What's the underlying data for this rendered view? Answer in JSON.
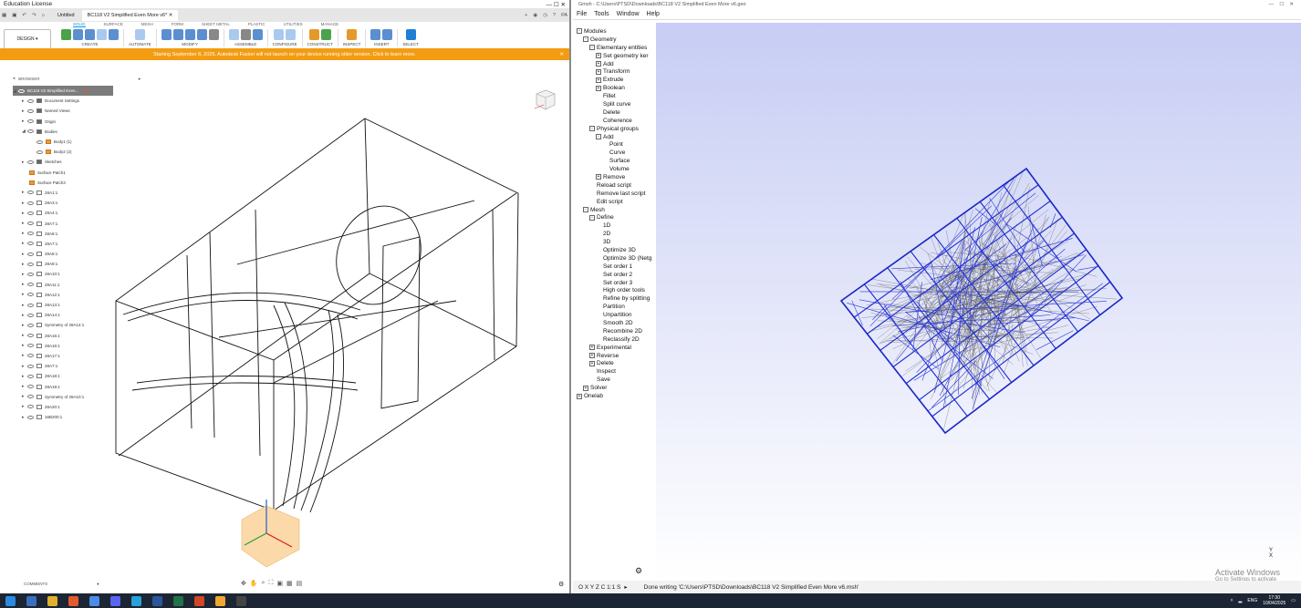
{
  "fusion": {
    "window_title": "Education License",
    "tabs": {
      "untitled": "Untitled",
      "active": "BC118 V2 Simplified Even More v6*"
    },
    "ribbon_tabs": [
      "SOLID",
      "SURFACE",
      "MESH",
      "FORM",
      "SHEET METAL",
      "PLASTIC",
      "UTILITIES",
      "MANAGE"
    ],
    "design_button": "DESIGN",
    "groups": [
      "CREATE",
      "AUTOMATE",
      "MODIFY",
      "ASSEMBLE",
      "CONFIGURE",
      "CONSTRUCT",
      "INSPECT",
      "INSERT",
      "SELECT"
    ],
    "banner": "Starting September 8, 2025, Autodesk Fusion will not launch on your device running older version. Click to learn more.",
    "browser_label": "BROWSER",
    "root_item": "BC118 V2 Simplified Even...",
    "tree_items": [
      "Document Settings",
      "Named Views",
      "Origin",
      "Bodies",
      "Body1 (1)",
      "Body2 (2)",
      "Sketches",
      "Surface Patch1",
      "Surface Patch3",
      "28A1:1",
      "28A3:1",
      "28A4:1",
      "28A7:1",
      "28A8:1",
      "28A7:1",
      "28A6:1",
      "28A8:1",
      "28A10:1",
      "28A11:1",
      "28A12:1",
      "28A13:1",
      "28A14:1",
      "Symmetry of 28A14:1",
      "28A15:1",
      "28A16:1",
      "28A17:1",
      "28A7:1",
      "28A18:1",
      "28A19:1",
      "Symmetry of 28A10:1",
      "28A20:1",
      "16B200:1"
    ],
    "comments_label": "COMMENTS"
  },
  "gmsh": {
    "window_title": "Gmsh - C:\\Users\\PTSD\\Downloads\\BC118 V2 Simplified Even More v6.geo",
    "menu": [
      "File",
      "Tools",
      "Window",
      "Help"
    ],
    "tree": [
      {
        "t": "Modules",
        "d": 0,
        "pm": "-"
      },
      {
        "t": "Geometry",
        "d": 1,
        "pm": "-"
      },
      {
        "t": "Elementary entities",
        "d": 2,
        "pm": "-"
      },
      {
        "t": "Set geometry ker",
        "d": 3,
        "pm": "+"
      },
      {
        "t": "Add",
        "d": 3,
        "pm": "+"
      },
      {
        "t": "Transform",
        "d": 3,
        "pm": "+"
      },
      {
        "t": "Extrude",
        "d": 3,
        "pm": "+"
      },
      {
        "t": "Boolean",
        "d": 3,
        "pm": "+"
      },
      {
        "t": "Fillet",
        "d": 3,
        "pm": ""
      },
      {
        "t": "Split curve",
        "d": 3,
        "pm": ""
      },
      {
        "t": "Delete",
        "d": 3,
        "pm": ""
      },
      {
        "t": "Coherence",
        "d": 3,
        "pm": ""
      },
      {
        "t": "Physical groups",
        "d": 2,
        "pm": "-"
      },
      {
        "t": "Add",
        "d": 3,
        "pm": "-"
      },
      {
        "t": "Point",
        "d": 4,
        "pm": ""
      },
      {
        "t": "Curve",
        "d": 4,
        "pm": ""
      },
      {
        "t": "Surface",
        "d": 4,
        "pm": ""
      },
      {
        "t": "Volume",
        "d": 4,
        "pm": ""
      },
      {
        "t": "Remove",
        "d": 3,
        "pm": "+"
      },
      {
        "t": "Reload script",
        "d": 2,
        "pm": ""
      },
      {
        "t": "Remove last script",
        "d": 2,
        "pm": ""
      },
      {
        "t": "Edit script",
        "d": 2,
        "pm": ""
      },
      {
        "t": "Mesh",
        "d": 1,
        "pm": "-"
      },
      {
        "t": "Define",
        "d": 2,
        "pm": "-"
      },
      {
        "t": "1D",
        "d": 3,
        "pm": ""
      },
      {
        "t": "2D",
        "d": 3,
        "pm": ""
      },
      {
        "t": "3D",
        "d": 3,
        "pm": ""
      },
      {
        "t": "Optimize 3D",
        "d": 3,
        "pm": ""
      },
      {
        "t": "Optimize 3D (Netg",
        "d": 3,
        "pm": ""
      },
      {
        "t": "Set order 1",
        "d": 3,
        "pm": ""
      },
      {
        "t": "Set order 2",
        "d": 3,
        "pm": ""
      },
      {
        "t": "Set order 3",
        "d": 3,
        "pm": ""
      },
      {
        "t": "High order tools",
        "d": 3,
        "pm": ""
      },
      {
        "t": "Refine by splitting",
        "d": 3,
        "pm": ""
      },
      {
        "t": "Partition",
        "d": 3,
        "pm": ""
      },
      {
        "t": "Unpartition",
        "d": 3,
        "pm": ""
      },
      {
        "t": "Smooth 2D",
        "d": 3,
        "pm": ""
      },
      {
        "t": "Recombine 2D",
        "d": 3,
        "pm": ""
      },
      {
        "t": "Reclassify 2D",
        "d": 3,
        "pm": ""
      },
      {
        "t": "Experimental",
        "d": 2,
        "pm": "+"
      },
      {
        "t": "Reverse",
        "d": 2,
        "pm": "+"
      },
      {
        "t": "Delete",
        "d": 2,
        "pm": "+"
      },
      {
        "t": "Inspect",
        "d": 2,
        "pm": ""
      },
      {
        "t": "Save",
        "d": 2,
        "pm": ""
      },
      {
        "t": "Solver",
        "d": 1,
        "pm": "+"
      },
      {
        "t": "Onelab",
        "d": 0,
        "pm": "+"
      }
    ],
    "status_buttons": "O X Y Z C 1:1 S",
    "status_text": "Done writing 'C:\\Users\\PTSD\\Downloads\\BC118 V2 Simplified Even More v6.msh'",
    "watermark_title": "Activate Windows",
    "watermark_sub": "Go to Settings to activate Windows.",
    "axis_label": "X",
    "axis_y": "Y"
  },
  "taskbar": {
    "language": "ENG",
    "time": "17:30",
    "date": "10/04/2025"
  }
}
